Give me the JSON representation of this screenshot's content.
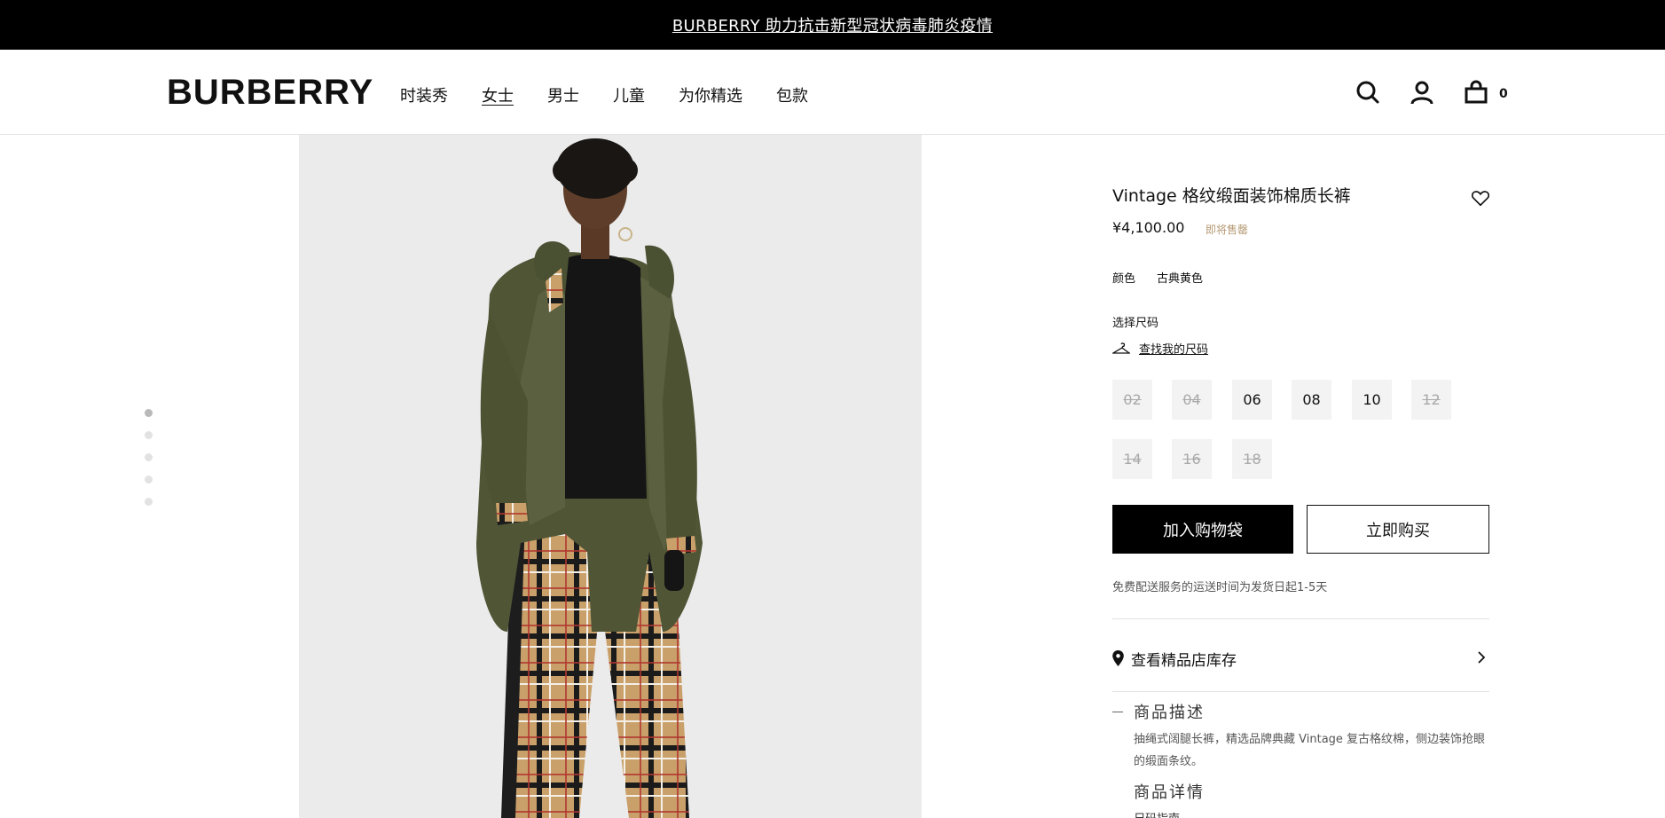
{
  "banner": {
    "text": "BURBERRY 助力抗击新型冠状病毒肺炎疫情"
  },
  "header": {
    "logo": "BURBERRY",
    "nav": [
      "时装秀",
      "女士",
      "男士",
      "儿童",
      "为你精选",
      "包款"
    ],
    "active_nav": "女士",
    "bag_count": "0",
    "icons": [
      "search-icon",
      "user-icon",
      "bag-icon"
    ]
  },
  "gallery": {
    "dot_count": 5,
    "active_dot": 1
  },
  "product": {
    "title": "Vintage 格纹缎面装饰棉质长裤",
    "price": "¥4,100.00",
    "status": "即将售罄",
    "color_label": "颜色",
    "color_value": "古典黄色",
    "size_label": "选择尺码",
    "size_finder": "查找我的尺码",
    "sizes": [
      {
        "label": "02",
        "available": false
      },
      {
        "label": "04",
        "available": false
      },
      {
        "label": "06",
        "available": true
      },
      {
        "label": "08",
        "available": true
      },
      {
        "label": "10",
        "available": true
      },
      {
        "label": "12",
        "available": false
      },
      {
        "label": "14",
        "available": false
      },
      {
        "label": "16",
        "available": false
      },
      {
        "label": "18",
        "available": false
      }
    ],
    "add_to_bag": "加入购物袋",
    "buy_now": "立即购买",
    "shipping": "免费配送服务的运送时间为发货日起1-5天",
    "store_stock": "查看精品店库存",
    "description_title": "商品描述",
    "description_body": "抽绳式阔腿长裤，精选品牌典藏 Vintage 复古格纹棉，侧边装饰抢眼的缎面条纹。",
    "details_title": "商品详情",
    "size_guide": "尺码指南"
  },
  "colors": {
    "banner_bg": "#000000",
    "accent_status": "#b69a74",
    "button_primary": "#000000"
  }
}
